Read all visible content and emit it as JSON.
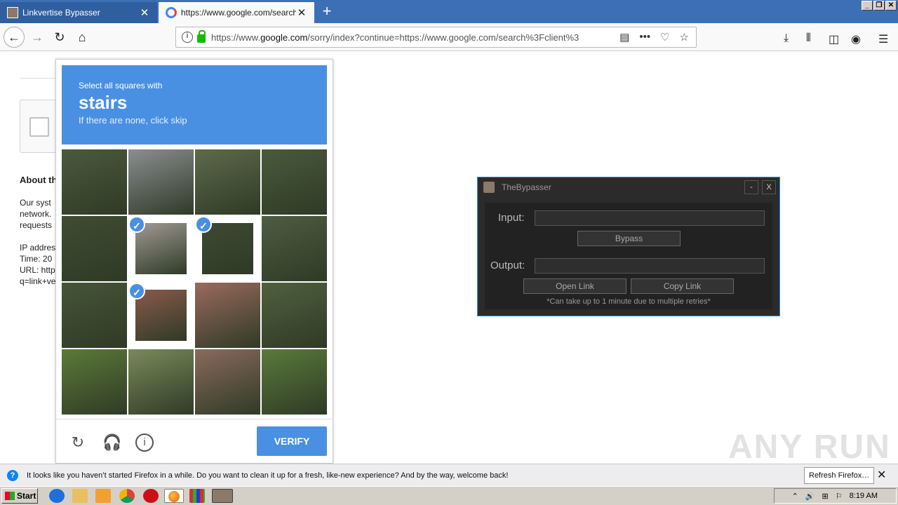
{
  "browser": {
    "tabs": [
      {
        "title": "Linkvertise Bypasser",
        "active": false
      },
      {
        "title": "https://www.google.com/search?c",
        "active": true
      }
    ],
    "url_prefix": "https://www.",
    "url_domain": "google.com",
    "url_rest": "/sorry/index?continue=https://www.google.com/search%3Fclient%3",
    "new_tab": "+",
    "close": "✕"
  },
  "page": {
    "about_heading": "About th",
    "body_lines": [
      "Our syst",
      "network.",
      "requests"
    ],
    "info_lines": [
      "IP addres",
      "Time: 20",
      "URL: http",
      "q=link+ve"
    ]
  },
  "captcha": {
    "instruction": "Select all squares with",
    "object": "stairs",
    "hint": "If there are none, click skip",
    "verify_label": "VERIFY",
    "selected_cells": [
      5,
      6,
      9
    ],
    "cell_colors": [
      "#4b5a3d",
      "#8b8e92",
      "#5d6b4a",
      "#4a5a3d",
      "#3f4c33",
      "#a09a94",
      "#3d4a33",
      "#4e5d41",
      "#465538",
      "#8a5a4a",
      "#9a6a5c",
      "#50603e",
      "#5c7a38",
      "#7a8a5a",
      "#8a6a5c",
      "#5a7a3a"
    ]
  },
  "bypasser": {
    "title": "TheBypasser",
    "minimize": "-",
    "close": "X",
    "input_label": "Input:",
    "bypass_label": "Bypass",
    "output_label": "Output:",
    "open_link_label": "Open Link",
    "copy_link_label": "Copy Link",
    "note": "*Can take up to 1 minute due to multiple retries*"
  },
  "watermark": "ANY RUN",
  "notification": {
    "message": "It looks like you haven’t started Firefox in a while. Do you want to clean it up for a fresh, like-new experience? And by the way, welcome back!",
    "refresh_label": "Refresh Firefox…",
    "close": "✕"
  },
  "taskbar": {
    "start_label": "Start",
    "time": "8:19 AM"
  }
}
